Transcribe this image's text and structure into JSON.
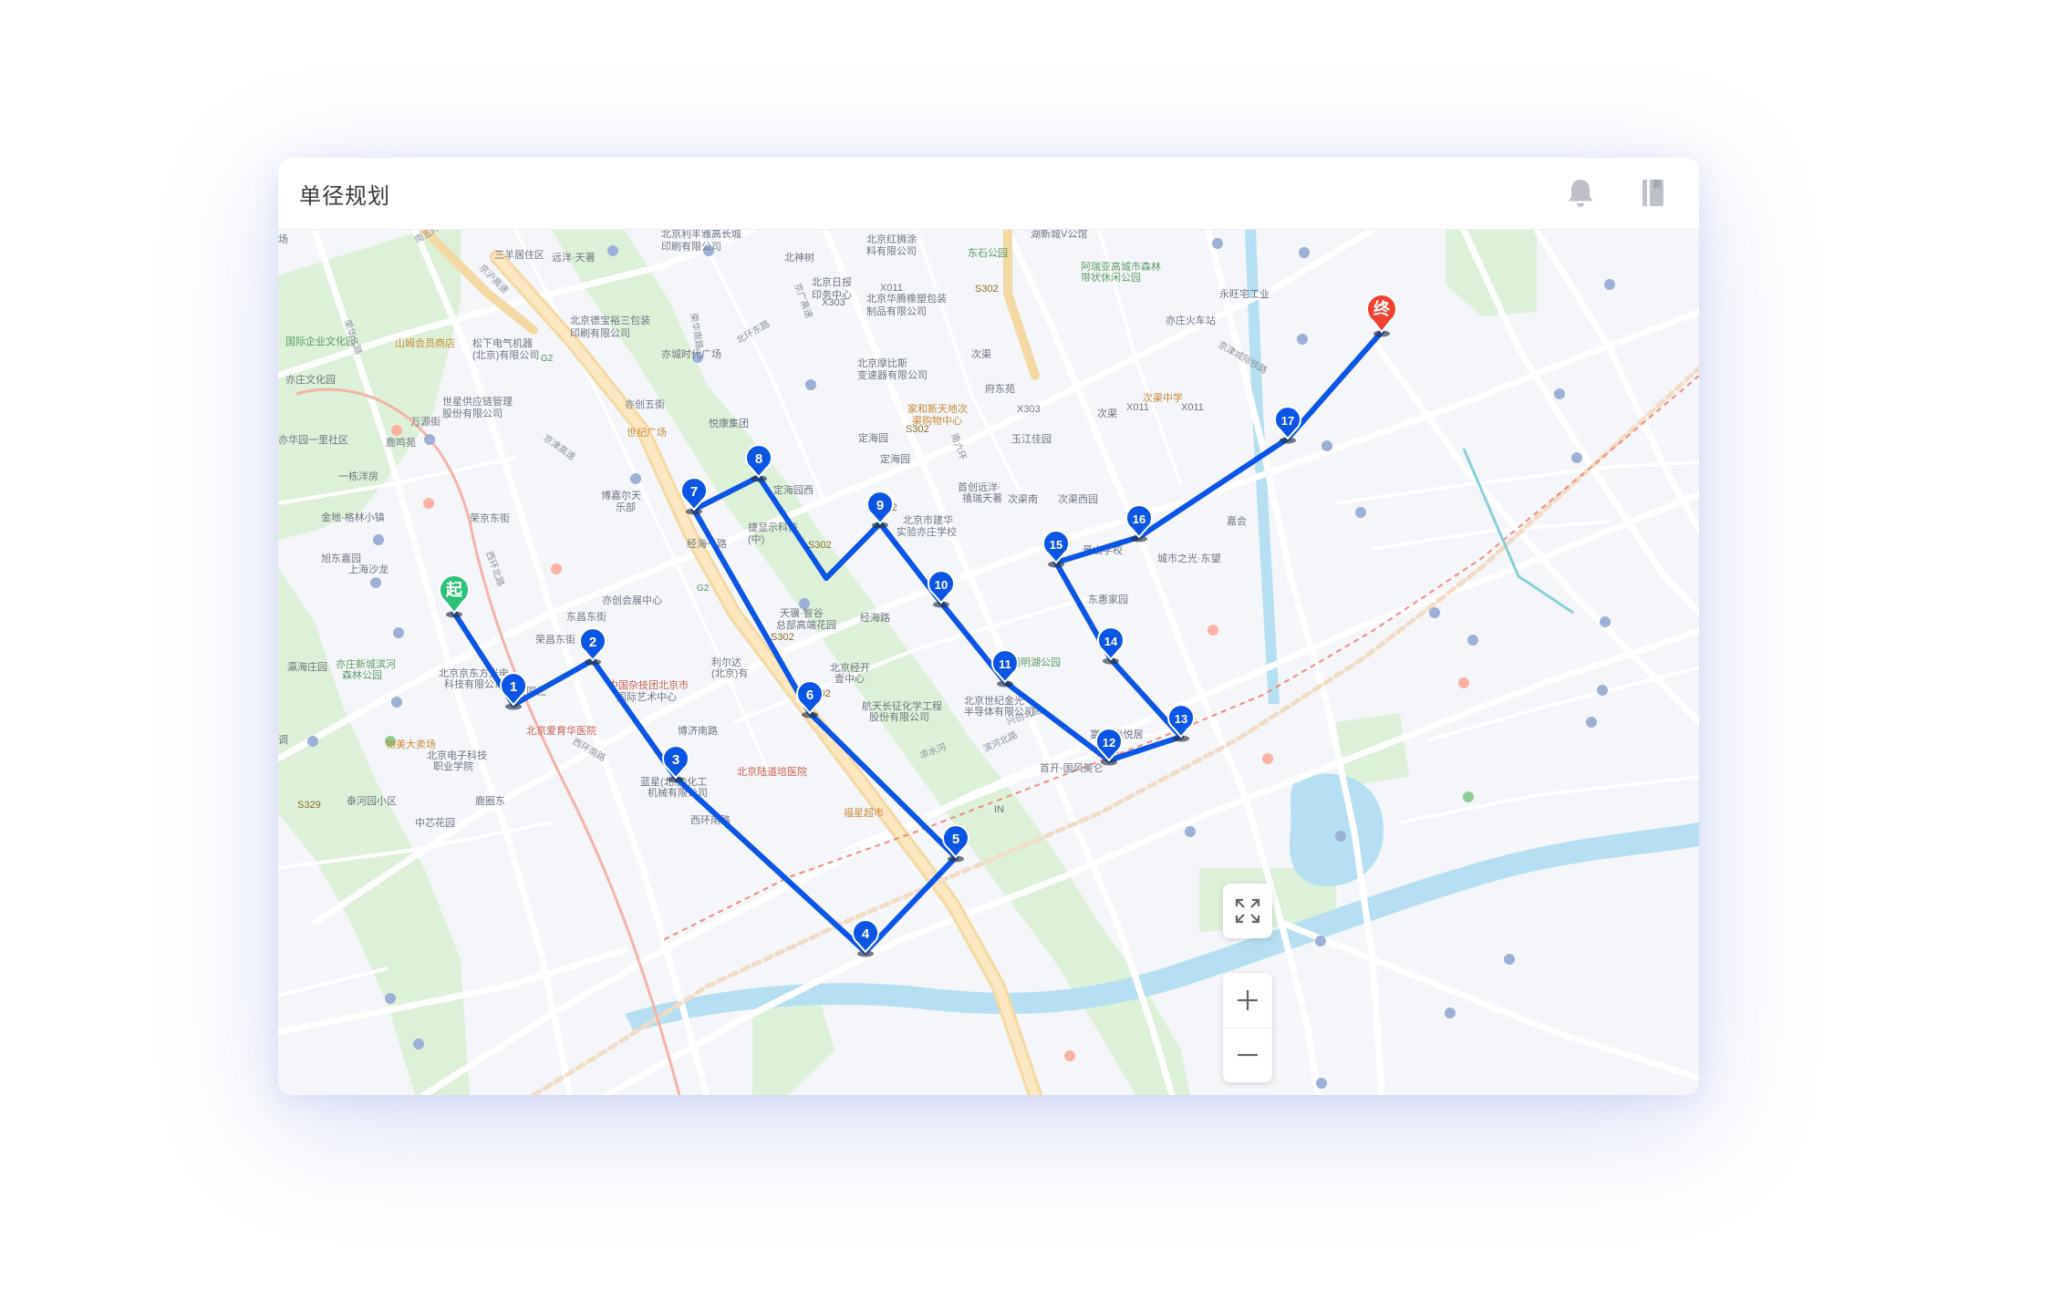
{
  "app": {
    "title": "单径规划"
  },
  "header_icons": [
    "bell-icon",
    "bookmark-icon"
  ],
  "colors": {
    "route": "#0a55e3",
    "start_marker": "#2bc176",
    "end_marker": "#f0412e",
    "highway_badge": "#e9b04a",
    "green_area": "#ddf1d8",
    "water": "#b7dff1"
  },
  "route": {
    "start_label": "起",
    "end_label": "终",
    "stops": [
      "1",
      "2",
      "3",
      "4",
      "5",
      "6",
      "7",
      "8",
      "9",
      "10",
      "11",
      "12",
      "13",
      "14",
      "15",
      "16",
      "17"
    ]
  },
  "map_labels": {
    "l01": "北京利丰雅高长城",
    "l02": "印刷有限公司",
    "l03": "北京红狮涂",
    "l04": "料有限公司",
    "l05": "湖新城V公馆",
    "l06": "三羊居住区",
    "l07": "远洋·天著",
    "l08": "北神树",
    "l09": "北京日报",
    "l10": "印务中心",
    "l11": "X011",
    "l12": "北京华腾橡塑包装",
    "l13": "制品有限公司",
    "l14": "X303",
    "l15": "S302",
    "l16": "东石公园",
    "l17": "阿瑞亚高城市森林",
    "l18": "带状休闲公园",
    "l19": "永旺宅工业",
    "l20": "亦庄火车站",
    "l21": "北京德宝裕三包装",
    "l22": "印刷有限公司",
    "l23": "山姆会员商店",
    "l24": "国际企业文化园",
    "l25": "松下电气机器",
    "l26": "(北京)有限公司",
    "l27": "亦城时代广场",
    "l28": "北京摩比斯",
    "l29": "变速器有限公司",
    "l30": "次渠",
    "l31": "府东苑",
    "l32": "亦庄文化园",
    "l33": "世星供应链管理",
    "l34": "股份有限公司",
    "l35": "万源街",
    "l36": "亦创五街",
    "l37": "悦康集团",
    "l38": "家和新天地次",
    "l39": "渠购物中心",
    "l40": "次渠中学",
    "l41": "X303",
    "l42": "X011",
    "l43": "X011",
    "l44": "次渠",
    "l45": "亦华园一里社区",
    "l46": "鹿鸣苑",
    "l47": "世纪广场",
    "l48": "定海园",
    "l49": "S302",
    "l50": "玉江佳园",
    "l51": "定海园",
    "l52": "一栋洋房",
    "l53": "博嘉尔天",
    "l54": "乐部",
    "l55": "定海园西",
    "l56": "首创远洋·",
    "l57": "禧瑞天著",
    "l58": "次渠南",
    "l59": "次渠西园",
    "l60": "金地·格林小镇",
    "l61": "荣京东街",
    "l62": "捷显示科技",
    "l63": "(中)",
    "l64": "经海一路",
    "l65": "S302",
    "l66": "北京市建华",
    "l67": "实验亦庄学校",
    "l68": "景山学校",
    "l69": "嘉会",
    "l70": "旭东嘉园",
    "l71": "上海沙龙",
    "l72": "城市之光·东望",
    "l73": "S302",
    "l74": "亦创会展中心",
    "l75": "经海路",
    "l76": "东惠家园",
    "l77": "东昌东街",
    "l78": "天骥·智谷",
    "l79": "总部高端花园",
    "l80": "S302",
    "l81": "荣昌东街",
    "l82": "瀛海庄园",
    "l83": "亦庄新城滨河",
    "l84": "森林公园",
    "l85": "北京京东方光电",
    "l86": "科技有限公司",
    "l87": "利尔达",
    "l88": "(北京)有",
    "l89": "北京经开",
    "l90": "壹中心",
    "l91": "通明湖公园",
    "l92": "亦庄同仁",
    "l93": "中国杂技团北京市",
    "l94": "国际艺术中心",
    "l95": "S302",
    "l96": "航天长征化学工程",
    "l97": "股份有限公司",
    "l98": "北京世纪金光",
    "l99": "半导体有限公司",
    "l100": "北京爱育华医院",
    "l101": "博济南路",
    "l102": "富力·尚悦居",
    "l103": "物美大卖场",
    "l104": "北京电子科技",
    "l105": "职业学院",
    "l106": "北京陆道培医院",
    "l107": "Y543",
    "l108": "首开·国风美仑",
    "l109": "蓝星(北京)化工",
    "l110": "机械有限公司",
    "l111": "泰河园小区",
    "l112": "鹿圈东",
    "l113": "S329",
    "l114": "中芯花园",
    "l115": "西环南路",
    "l116": "福星超市",
    "l117": "兴创北路",
    "l118": "南五环",
    "l119": "京沪高速",
    "l120": "荣华北路",
    "l121": "京津高速",
    "l122": "北环东路",
    "l123": "南六环",
    "l124": "西环北路",
    "l125": "京广高速",
    "l126": "荣华南路",
    "l127": "西环南路",
    "l128": "凉水河",
    "l129": "G2",
    "l130": "G2",
    "l131": "滨河北路",
    "l132": "京津城际铁路",
    "l133": "IN",
    "l134": "场",
    "l135": "调"
  }
}
